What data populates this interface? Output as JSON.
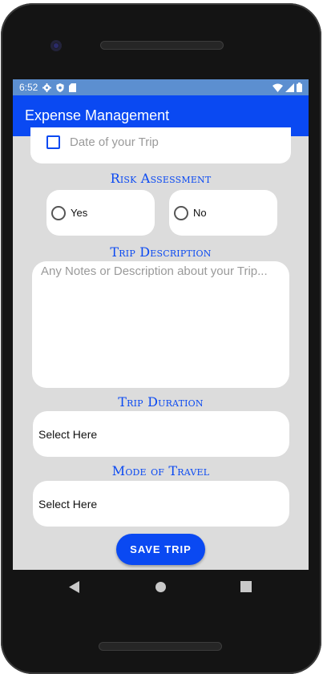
{
  "status_bar": {
    "time": "6:52"
  },
  "app_bar": {
    "title": "Expense Management"
  },
  "form": {
    "date_placeholder": "Date of your Trip",
    "risk_title": "Risk Assessment",
    "risk_options": [
      {
        "label": "Yes",
        "selected": false
      },
      {
        "label": "No",
        "selected": false
      }
    ],
    "description_title": "Trip Description",
    "description_placeholder": "Any Notes or Description about your Trip...",
    "duration_title": "Trip Duration",
    "duration_value": "Select Here",
    "mode_title": "Mode of Travel",
    "mode_value": "Select Here",
    "save_label": "Save Trip"
  },
  "colors": {
    "accent": "#0a49f2",
    "status_bar": "#5c8fd0",
    "background": "#dcdcdc"
  },
  "icons": {
    "status_left": [
      "settings-icon",
      "shield-icon",
      "sd-card-icon"
    ],
    "status_right": [
      "wifi-icon",
      "signal-icon",
      "battery-icon"
    ],
    "nav": [
      "back-icon",
      "home-icon",
      "recents-icon"
    ]
  }
}
